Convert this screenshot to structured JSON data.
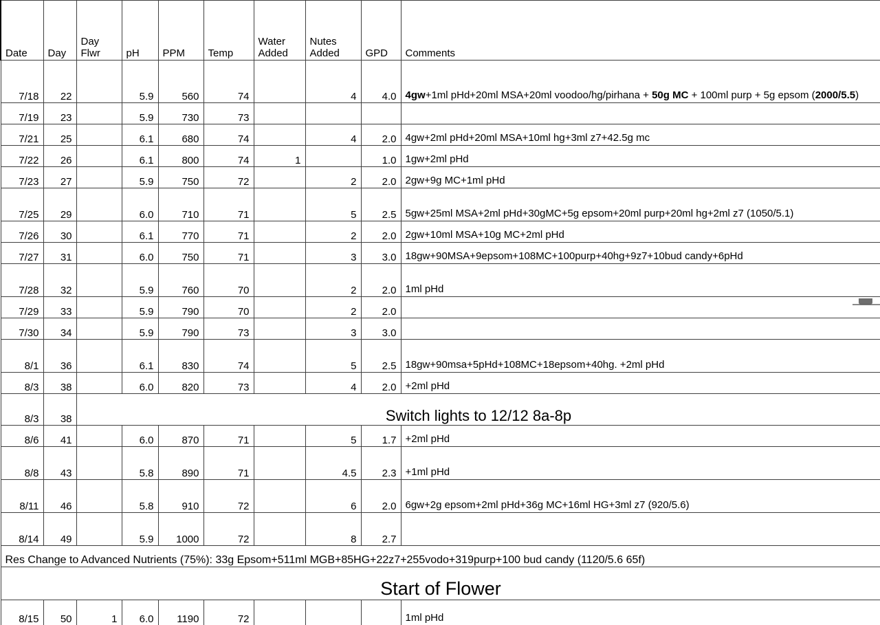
{
  "table": {
    "headers": [
      {
        "id": "date",
        "label": "Date"
      },
      {
        "id": "day",
        "label": "Day"
      },
      {
        "id": "day_flwr",
        "label": "Day\nFlwr"
      },
      {
        "id": "ph",
        "label": "pH"
      },
      {
        "id": "ppm",
        "label": "PPM"
      },
      {
        "id": "temp",
        "label": "Temp"
      },
      {
        "id": "water_added",
        "label": "Water\nAdded"
      },
      {
        "id": "nutes_added",
        "label": "Nutes\nAdded"
      },
      {
        "id": "gpd",
        "label": "GPD"
      },
      {
        "id": "comments",
        "label": "Comments"
      }
    ],
    "header_labels": {
      "date": "Date",
      "day": "Day",
      "day_flwr_line1": "Day",
      "day_flwr_line2": "Flwr",
      "ph": "pH",
      "ppm": "PPM",
      "temp": "Temp",
      "water_added_line1": "Water",
      "water_added_line2": "Added",
      "nutes_added_line1": "Nutes",
      "nutes_added_line2": "Added",
      "gpd": "GPD",
      "comments": "Comments"
    },
    "rows": [
      {
        "date": "7/18",
        "day": "22",
        "day_flwr": "",
        "ph": "5.9",
        "ppm": "560",
        "temp": "74",
        "water": "",
        "nutes": "4",
        "gpd": "4.0",
        "comment": "4gw+1ml pHd+20ml MSA+20ml voodoo/hg/pirhana + 50g MC + 100ml purp + 5g epsom (2000/5.5)",
        "comment_bold_parts": [
          "4gw",
          "50g MC",
          "2000/5.5"
        ]
      },
      {
        "date": "7/19",
        "day": "23",
        "day_flwr": "",
        "ph": "5.9",
        "ppm": "730",
        "temp": "73",
        "water": "",
        "nutes": "",
        "gpd": "",
        "comment": ""
      },
      {
        "date": "7/21",
        "day": "25",
        "day_flwr": "",
        "ph": "6.1",
        "ppm": "680",
        "temp": "74",
        "water": "",
        "nutes": "4",
        "gpd": "2.0",
        "comment": "4gw+2ml pHd+20ml MSA+10ml hg+3ml z7+42.5g mc"
      },
      {
        "date": "7/22",
        "day": "26",
        "day_flwr": "",
        "ph": "6.1",
        "ppm": "800",
        "temp": "74",
        "water": "1",
        "nutes": "",
        "gpd": "1.0",
        "comment": "1gw+2ml pHd"
      },
      {
        "date": "7/23",
        "day": "27",
        "day_flwr": "",
        "ph": "5.9",
        "ppm": "750",
        "temp": "72",
        "water": "",
        "nutes": "2",
        "gpd": "2.0",
        "comment": "2gw+9g MC+1ml pHd"
      },
      {
        "date": "7/25",
        "day": "29",
        "day_flwr": "",
        "ph": "6.0",
        "ppm": "710",
        "temp": "71",
        "water": "",
        "nutes": "5",
        "gpd": "2.5",
        "comment": "5gw+25ml MSA+2ml pHd+30gMC+5g epsom+20ml purp+20ml hg+2ml z7 (1050/5.1)"
      },
      {
        "date": "7/26",
        "day": "30",
        "day_flwr": "",
        "ph": "6.1",
        "ppm": "770",
        "temp": "71",
        "water": "",
        "nutes": "2",
        "gpd": "2.0",
        "comment": "2gw+10ml MSA+10g MC+2ml pHd"
      },
      {
        "date": "7/27",
        "day": "31",
        "day_flwr": "",
        "ph": "6.0",
        "ppm": "750",
        "temp": "71",
        "water": "",
        "nutes": "3",
        "gpd": "3.0",
        "comment": "18gw+90MSA+9epsom+108MC+100purp+40hg+9z7+10bud candy+6pHd"
      },
      {
        "date": "7/28",
        "day": "32",
        "day_flwr": "",
        "ph": "5.9",
        "ppm": "760",
        "temp": "70",
        "water": "",
        "nutes": "2",
        "gpd": "2.0",
        "comment": "1ml pHd"
      },
      {
        "date": "7/29",
        "day": "33",
        "day_flwr": "",
        "ph": "5.9",
        "ppm": "790",
        "temp": "70",
        "water": "",
        "nutes": "2",
        "gpd": "2.0",
        "comment": ""
      },
      {
        "date": "7/30",
        "day": "34",
        "day_flwr": "",
        "ph": "5.9",
        "ppm": "790",
        "temp": "73",
        "water": "",
        "nutes": "3",
        "gpd": "3.0",
        "comment": ""
      },
      {
        "date": "8/1",
        "day": "36",
        "day_flwr": "",
        "ph": "6.1",
        "ppm": "830",
        "temp": "74",
        "water": "",
        "nutes": "5",
        "gpd": "2.5",
        "comment": "18gw+90msa+5pHd+108MC+18epsom+40hg.    +2ml pHd"
      },
      {
        "date": "8/3",
        "day": "38",
        "day_flwr": "",
        "ph": "6.0",
        "ppm": "820",
        "temp": "73",
        "water": "",
        "nutes": "4",
        "gpd": "2.0",
        "comment": "+2ml pHd"
      },
      {
        "date": "8/6",
        "day": "41",
        "day_flwr": "",
        "ph": "6.0",
        "ppm": "870",
        "temp": "71",
        "water": "",
        "nutes": "5",
        "gpd": "1.7",
        "comment": "+2ml pHd"
      },
      {
        "date": "8/8",
        "day": "43",
        "day_flwr": "",
        "ph": "5.8",
        "ppm": "890",
        "temp": "71",
        "water": "",
        "nutes": "4.5",
        "gpd": "2.3",
        "comment": "+1ml pHd"
      },
      {
        "date": "8/11",
        "day": "46",
        "day_flwr": "",
        "ph": "5.8",
        "ppm": "910",
        "temp": "72",
        "water": "",
        "nutes": "6",
        "gpd": "2.0",
        "comment": "6gw+2g epsom+2ml pHd+36g MC+16ml HG+3ml z7 (920/5.6)"
      },
      {
        "date": "8/14",
        "day": "49",
        "day_flwr": "",
        "ph": "5.9",
        "ppm": "1000",
        "temp": "72",
        "water": "",
        "nutes": "8",
        "gpd": "2.7",
        "comment": ""
      },
      {
        "date": "8/15",
        "day": "50",
        "day_flwr": "1",
        "ph": "6.0",
        "ppm": "1190",
        "temp": "72",
        "water": "",
        "nutes": "",
        "gpd": "",
        "comment": "1ml pHd"
      }
    ],
    "banners": {
      "switch_lights": {
        "date": "8/3",
        "day": "38",
        "text": "Switch lights to 12/12 8a-8p"
      },
      "res_change": {
        "text": "Res Change to Advanced Nutrients (75%): 33g Epsom+511ml MGB+85HG+22z7+255vodo+319purp+100  bud candy (1120/5.6 65f)"
      },
      "start_of_flower": {
        "text": "Start of Flower"
      }
    },
    "colors": {
      "header_fill": "#d5e3f0",
      "gpd_fill": "#fbe8c8",
      "grid_line": "#3f3f3f",
      "heavy_border": "#000000"
    }
  }
}
